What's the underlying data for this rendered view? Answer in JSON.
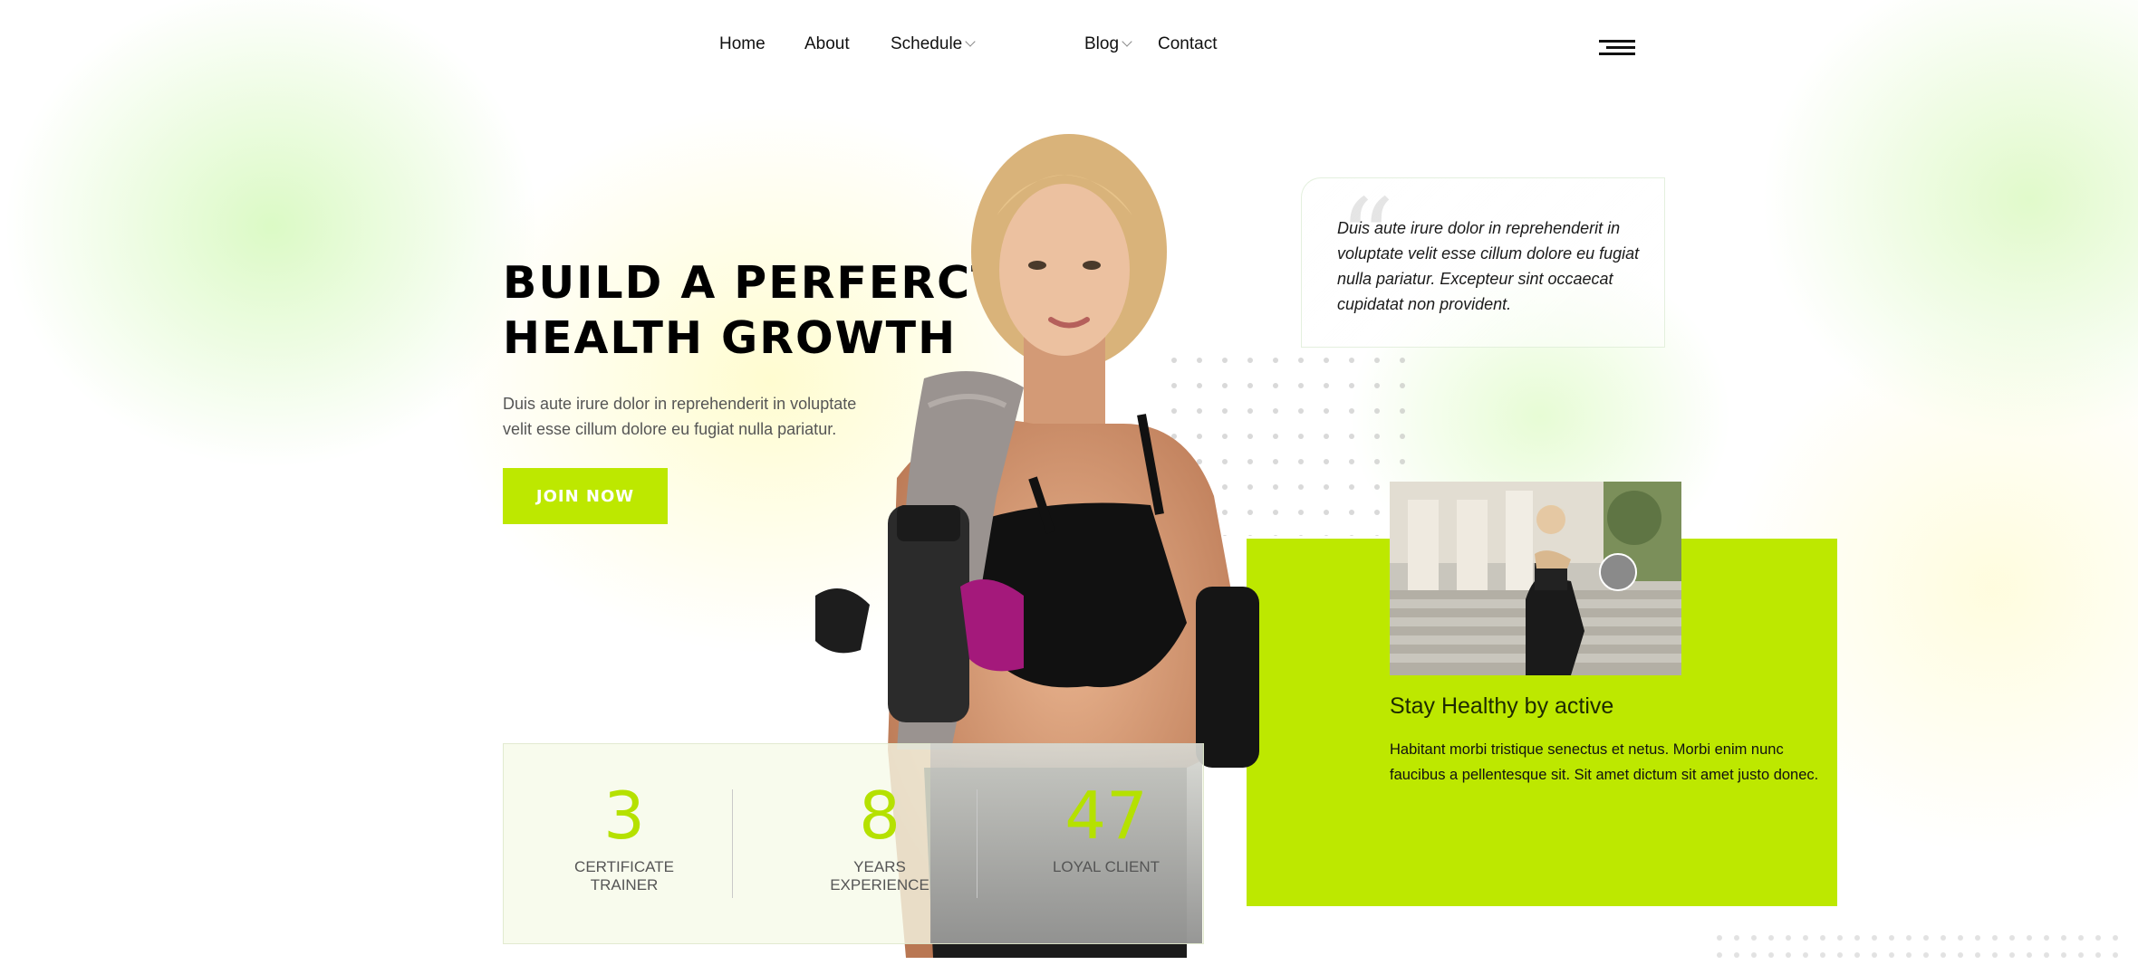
{
  "nav": {
    "items": [
      {
        "label": "Home",
        "has_dropdown": false
      },
      {
        "label": "About",
        "has_dropdown": false
      },
      {
        "label": "Schedule",
        "has_dropdown": true
      },
      {
        "label": "Blog",
        "has_dropdown": true
      },
      {
        "label": "Contact",
        "has_dropdown": false
      }
    ],
    "menu_icon": "hamburger-icon"
  },
  "hero": {
    "title_line1": "BUILD A PERFERCT",
    "title_line2": "HEALTH GROWTH",
    "description": "Duis aute irure dolor in reprehenderit in voluptate velit esse cillum dolore eu fugiat nulla pariatur.",
    "cta_label": "JOIN NOW"
  },
  "quote": {
    "text": "Duis aute irure dolor in reprehenderit in voluptate velit esse cillum dolore eu fugiat nulla pariatur. Excepteur sint occaecat cupidatat non provident."
  },
  "active": {
    "title": "Stay Healthy by active",
    "text": "Habitant morbi tristique senectus et netus. Morbi enim nunc faucibus a pellentesque sit. Sit amet dictum sit amet justo donec."
  },
  "stats": [
    {
      "number": "3",
      "label": "CERTIFICATE TRAINER"
    },
    {
      "number": "8",
      "label": "YEARS EXPERIENCE"
    },
    {
      "number": "47",
      "label": "LOYAL CLIENT"
    }
  ],
  "colors": {
    "accent": "#bde800",
    "text": "#111111",
    "muted": "#555555"
  }
}
